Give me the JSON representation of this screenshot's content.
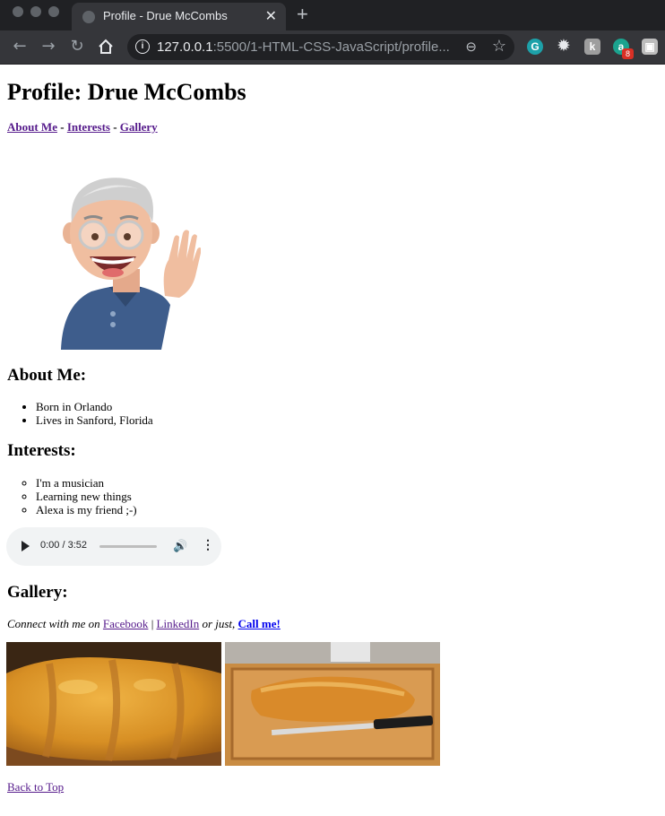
{
  "browser": {
    "tab_title": "Profile - Drue McCombs",
    "url_host": "127.0.0.1",
    "url_path": ":5500/1-HTML-CSS-JavaScript/profile...",
    "extension_badge": "8"
  },
  "page": {
    "heading": "Profile: Drue McCombs",
    "nav": [
      {
        "label": "About Me"
      },
      {
        "label": "Interests"
      },
      {
        "label": "Gallery"
      }
    ],
    "nav_separator": " - ",
    "about": {
      "heading": "About Me:",
      "items": [
        "Born in Orlando",
        "Lives in Sanford, Florida"
      ]
    },
    "interests": {
      "heading": "Interests:",
      "items": [
        "I'm a musician",
        "Learning new things",
        "Alexa is my friend ;-)"
      ]
    },
    "audio": {
      "time": "0:00 / 3:52",
      "progress": 0
    },
    "gallery": {
      "heading": "Gallery:",
      "connect_prefix": "Connect with me on ",
      "facebook": "Facebook",
      "separator": " | ",
      "linkedin": "LinkedIn",
      "or_just": " or just, ",
      "call": "Call me!"
    },
    "back_to_top": "Back to Top"
  },
  "colors": {
    "visited_link": "#551a8b",
    "link": "#0000ee",
    "chrome_dark": "#202124",
    "chrome_toolbar": "#35363a"
  }
}
